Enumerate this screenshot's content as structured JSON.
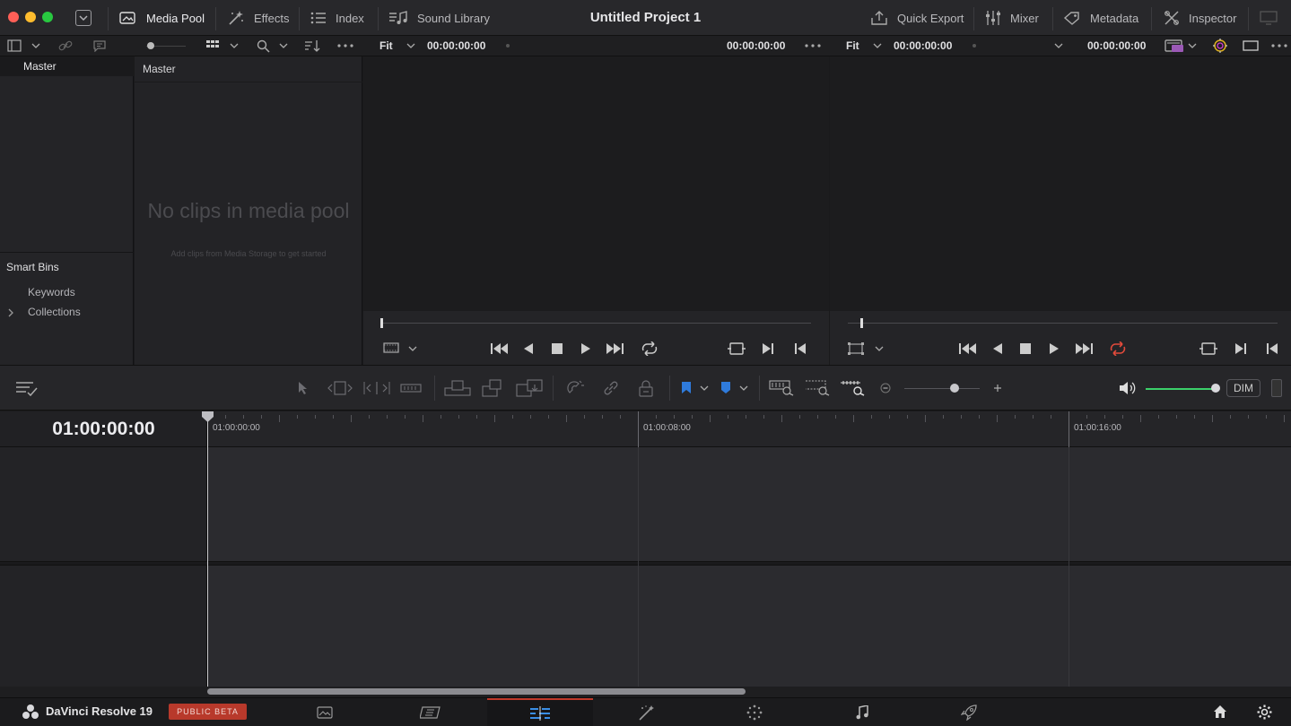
{
  "window": {
    "title": "Untitled Project 1"
  },
  "top_toolbar": {
    "media_pool": "Media Pool",
    "effects": "Effects",
    "index": "Index",
    "sound_library": "Sound Library",
    "quick_export": "Quick Export",
    "mixer": "Mixer",
    "metadata": "Metadata",
    "inspector": "Inspector"
  },
  "bins": {
    "master_label": "Master",
    "smart_bins_label": "Smart Bins",
    "items": [
      "Keywords",
      "Collections"
    ]
  },
  "media_pool": {
    "header": "Master",
    "empty_title": "No clips in media pool",
    "empty_hint": "Add clips from Media Storage to get started"
  },
  "source_viewer": {
    "zoom": "Fit",
    "timecode_left": "00:00:00:00",
    "timecode_right": "00:00:00:00"
  },
  "timeline_viewer": {
    "zoom": "Fit",
    "timecode_left": "00:00:00:00",
    "timecode_right": "00:00:00:00"
  },
  "timeline": {
    "current_timecode": "01:00:00:00",
    "ruler_labels": [
      "01:00:00:00",
      "01:00:08:00",
      "01:00:16:00"
    ],
    "dim_label": "DIM"
  },
  "app": {
    "name": "DaVinci Resolve 19",
    "badge": "PUBLIC BETA"
  },
  "pages": [
    "media",
    "cut",
    "edit",
    "fusion",
    "color",
    "fairlight",
    "deliver"
  ],
  "active_page": "edit",
  "colors": {
    "accent_red": "#c0392b",
    "accent_blue": "#2f7bdc",
    "volume_green": "#3bd06a",
    "loop_red": "#e14a3b"
  }
}
